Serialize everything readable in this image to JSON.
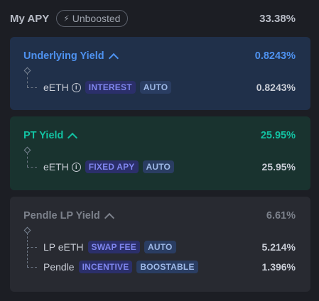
{
  "header": {
    "title": "My APY",
    "unboosted_label": "Unboosted",
    "total_apy": "33.38%"
  },
  "colors": {
    "underlying_accent": "#4e92f0",
    "pt_accent": "#12c2a2",
    "lp_accent": "#7c818b"
  },
  "underlying": {
    "title": "Underlying Yield",
    "value": "0.8243%",
    "rows": [
      {
        "name": "eETH",
        "tag1": "INTEREST",
        "tag2": "AUTO",
        "value": "0.8243%"
      }
    ]
  },
  "pt": {
    "title": "PT Yield",
    "value": "25.95%",
    "rows": [
      {
        "name": "eETH",
        "tag1": "FIXED APY",
        "tag2": "AUTO",
        "value": "25.95%"
      }
    ]
  },
  "lp": {
    "title": "Pendle LP Yield",
    "value": "6.61%",
    "rows": [
      {
        "name": "LP eETH",
        "tag1": "SWAP FEE",
        "tag2": "AUTO",
        "value": "5.214%"
      },
      {
        "name": "Pendle",
        "tag1": "INCENTIVE",
        "tag2": "BOOSTABLE",
        "value": "1.396%"
      }
    ]
  }
}
